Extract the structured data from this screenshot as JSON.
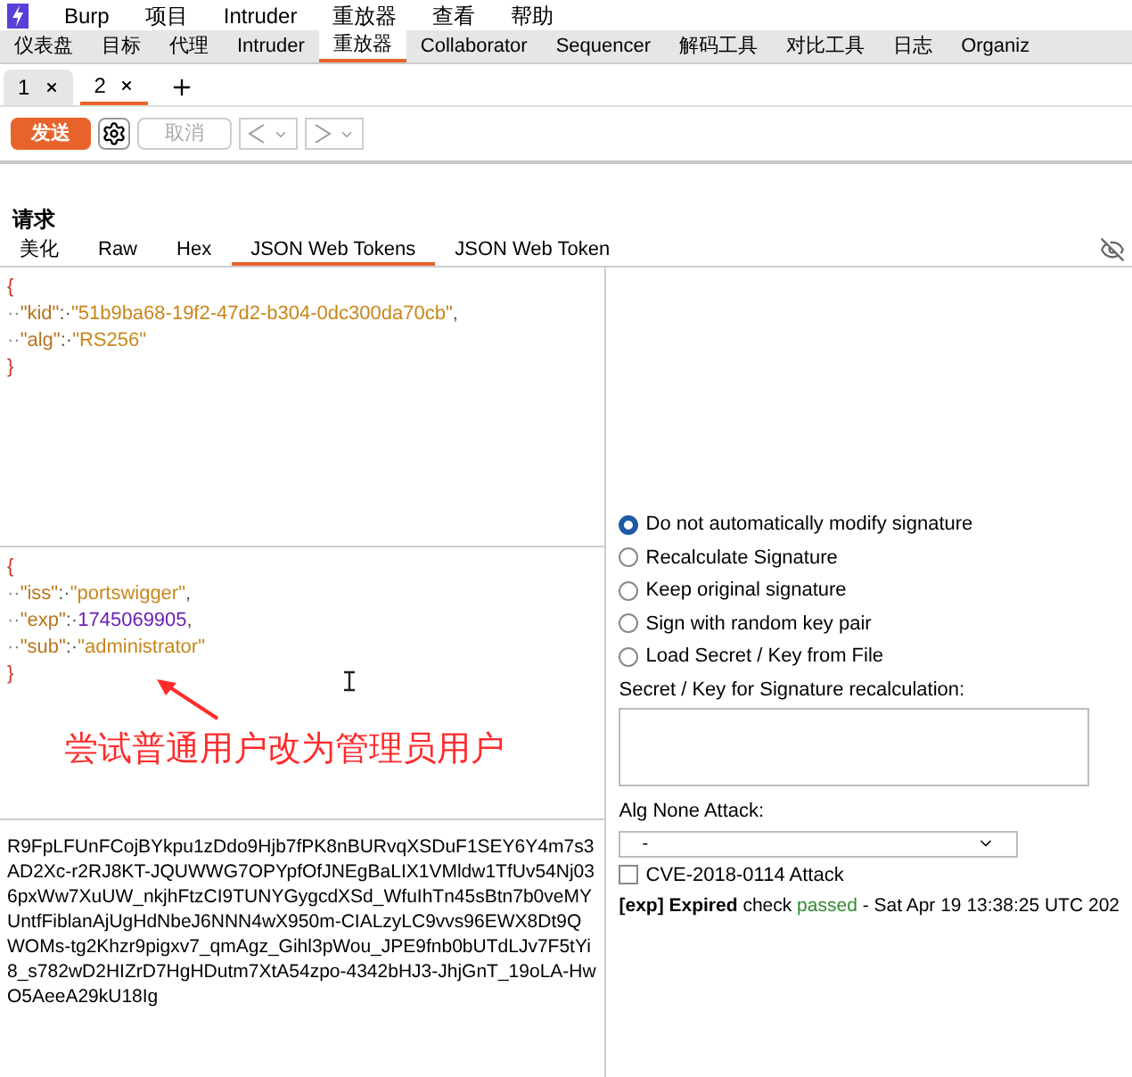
{
  "menu": [
    {
      "label": "Burp"
    },
    {
      "label": "项目"
    },
    {
      "label": "Intruder"
    },
    {
      "label": "重放器"
    },
    {
      "label": "查看"
    },
    {
      "label": "帮助"
    }
  ],
  "tool_tabs": [
    {
      "label": "仪表盘",
      "selected": false
    },
    {
      "label": "目标",
      "selected": false
    },
    {
      "label": "代理",
      "selected": false
    },
    {
      "label": "Intruder",
      "selected": false
    },
    {
      "label": "重放器",
      "selected": true
    },
    {
      "label": "Collaborator",
      "selected": false
    },
    {
      "label": "Sequencer",
      "selected": false
    },
    {
      "label": "解码工具",
      "selected": false
    },
    {
      "label": "对比工具",
      "selected": false
    },
    {
      "label": "日志",
      "selected": false
    },
    {
      "label": "Organiz",
      "selected": false
    }
  ],
  "repeater_tabs": [
    {
      "label": "1",
      "selected": false
    },
    {
      "label": "2",
      "selected": true
    }
  ],
  "toolbar": {
    "send": "发送",
    "cancel": "取消",
    "cancel_disabled": true
  },
  "request": {
    "title": "请求",
    "editor_tabs": [
      {
        "label": "美化",
        "selected": false
      },
      {
        "label": "Raw",
        "selected": false
      },
      {
        "label": "Hex",
        "selected": false
      },
      {
        "label": "JSON Web Tokens",
        "selected": true
      },
      {
        "label": "JSON Web Token",
        "selected": false
      }
    ],
    "header_lines": [
      [
        {
          "kind": "brace",
          "text": "{"
        }
      ],
      [
        {
          "kind": "ws",
          "text": "··"
        },
        {
          "kind": "key",
          "text": "\"kid\""
        },
        {
          "kind": "punct",
          "text": ":·"
        },
        {
          "kind": "string",
          "text": "\"51b9ba68-19f2-47d2-b304-0dc300da70cb\""
        },
        {
          "kind": "punct",
          "text": ","
        }
      ],
      [
        {
          "kind": "ws",
          "text": "··"
        },
        {
          "kind": "key",
          "text": "\"alg\""
        },
        {
          "kind": "punct",
          "text": ":·"
        },
        {
          "kind": "string",
          "text": "\"RS256\""
        }
      ],
      [
        {
          "kind": "brace",
          "text": "}"
        }
      ]
    ],
    "payload_lines": [
      [
        {
          "kind": "brace",
          "text": "{"
        }
      ],
      [
        {
          "kind": "ws",
          "text": "··"
        },
        {
          "kind": "key",
          "text": "\"iss\""
        },
        {
          "kind": "punct",
          "text": ":·"
        },
        {
          "kind": "string",
          "text": "\"portswigger\""
        },
        {
          "kind": "punct",
          "text": ","
        }
      ],
      [
        {
          "kind": "ws",
          "text": "··"
        },
        {
          "kind": "key",
          "text": "\"exp\""
        },
        {
          "kind": "punct",
          "text": ":·"
        },
        {
          "kind": "number",
          "text": "1745069905"
        },
        {
          "kind": "punct",
          "text": ","
        }
      ],
      [
        {
          "kind": "ws",
          "text": "··"
        },
        {
          "kind": "key",
          "text": "\"sub\""
        },
        {
          "kind": "punct",
          "text": ":·"
        },
        {
          "kind": "string",
          "text": "\"administrator\""
        }
      ],
      [
        {
          "kind": "brace",
          "text": "}"
        }
      ]
    ],
    "annotation": "尝试普通用户改为管理员用户",
    "token": "R9FpLFUnFCojBYkpu1zDdo9Hjb7fPK8nBURvqXSDuF1SEY6Y4m7s3AD2Xc-r2RJ8KT-JQUWWG7OPYpfOfJNEgBaLIX1VMldw1TfUv54Nj036pxWw7XuUW_nkjhFtzCI9TUNYGygcdXSd_WfuIhTn45sBtn7b0veMYUntfFiblanAjUgHdNbeJ6NNN4wX950m-CIALzyLC9vvs96EWX8Dt9QWOMs-tg2Khzr9pigxv7_qmAgz_Gihl3pWou_JPE9fnb0bUTdLJv7F5tYi8_s782wD2HIZrD7HgHDutm7XtA54zpo-4342bHJ3-JhjGnT_19oLA-HwO5AeeA29kU18Ig"
  },
  "signature": {
    "options": [
      {
        "label": "Do not automatically modify signature",
        "selected": true
      },
      {
        "label": "Recalculate Signature",
        "selected": false
      },
      {
        "label": "Keep original signature",
        "selected": false
      },
      {
        "label": "Sign with random key pair",
        "selected": false
      },
      {
        "label": "Load Secret / Key from File",
        "selected": false
      }
    ],
    "secret_label": "Secret / Key for Signature recalculation:",
    "alg_none_label": "Alg None Attack:",
    "alg_none_value": "-",
    "cve": {
      "label": "CVE-2018-0114 Attack",
      "checked": false
    },
    "status": [
      {
        "kind": "bold",
        "text": "[exp] Expired"
      },
      {
        "kind": "plain",
        "text": " check "
      },
      {
        "kind": "ok",
        "text": "passed"
      },
      {
        "kind": "plain",
        "text": " - Sat Apr 19 13:38:25 UTC 202"
      }
    ]
  }
}
